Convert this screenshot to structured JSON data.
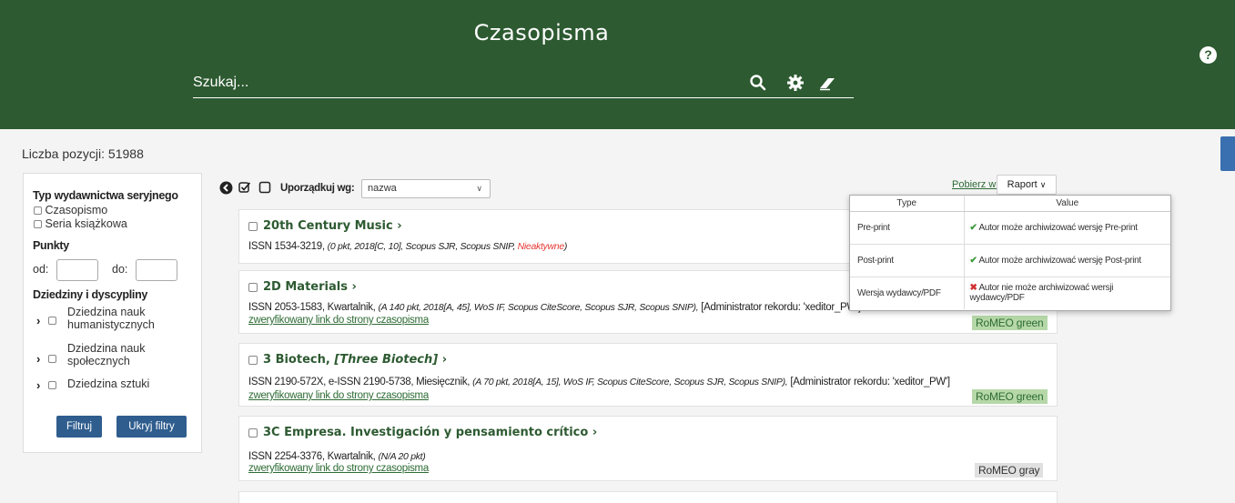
{
  "header": {
    "title": "Czasopisma",
    "search_placeholder": "Szukaj...",
    "help_symbol": "?"
  },
  "count_label": "Liczba pozycji: 51988",
  "filters": {
    "type_heading": "Typ wydawnictwa seryjnego",
    "type_options": [
      "Czasopismo",
      "Seria książkowa"
    ],
    "points_heading": "Punkty",
    "from_label": "od:",
    "to_label": "do:",
    "fields_heading": "Dziedziny i dyscypliny",
    "fields": [
      [
        "Dziedzina nauk",
        "humanistycznych"
      ],
      [
        "Dziedzina nauk",
        "społecznych"
      ],
      [
        "Dziedzina sztuki"
      ]
    ],
    "filter_button": "Filtruj",
    "hide_button": "Ukryj filtry"
  },
  "toolbar": {
    "sort_label": "Uporządkuj wg:",
    "sort_value": "nazwa",
    "download_label": "Pobierz w formacie:",
    "report_label": "Raport"
  },
  "items": [
    {
      "title": "20th Century Music",
      "title_suffix": "",
      "issn": "ISSN 1534-3219, ",
      "details": "(0 pkt, 2018[C, 10], Scopus SJR, Scopus SNIP, ",
      "inactive": "Nieaktywne",
      "details_end": ")",
      "link": "",
      "badge": ""
    },
    {
      "title": "2D Materials",
      "title_suffix": "",
      "issn": "ISSN 2053-1583, Kwartalnik, ",
      "details": "(A 140 pkt, 2018[A, 45], WoS IF, Scopus CiteScore, Scopus SJR, Scopus SNIP),",
      "admin": " [Administrator rekordu: 'xeditor_PW']",
      "link": "zweryfikowany link do strony czasopisma",
      "badge": "RoMEO green"
    },
    {
      "title": "3 Biotech, ",
      "title_suffix": "[Three Biotech]",
      "issn": "ISSN 2190-572X, e-ISSN 2190-5738, Miesięcznik, ",
      "details": "(A 70 pkt, 2018[A, 15], WoS IF, Scopus CiteScore, Scopus SJR, Scopus SNIP),",
      "admin": " [Administrator rekordu: 'xeditor_PW']",
      "link": "zweryfikowany link do strony czasopisma",
      "badge": "RoMEO green"
    },
    {
      "title": "3C Empresa. Investigación y pensamiento crítico",
      "title_suffix": "",
      "issn": "ISSN 2254-3376, Kwartalnik, ",
      "details": "(N/A 20 pkt)",
      "link": "zweryfikowany link do strony czasopisma",
      "badge": "RoMEO gray"
    }
  ],
  "popup": {
    "col_type": "Type",
    "col_value": "Value",
    "rows": [
      {
        "type": "Pre-print",
        "status": "ok",
        "value": "Autor może archiwizować wersję Pre-print"
      },
      {
        "type": "Post-print",
        "status": "ok",
        "value": "Autor może archiwizować wersję Post-print"
      },
      {
        "type": "Wersja wydawcy/PDF",
        "status": "no",
        "value": "Autor nie może archiwizować wersji wydawcy/PDF"
      }
    ]
  },
  "colors": {
    "header_bg": "#2d5a31",
    "link_green": "#2d6b34",
    "button_blue": "#2f5d8e",
    "badge_green": "#b6d8a8",
    "inactive_red": "#e53935"
  }
}
